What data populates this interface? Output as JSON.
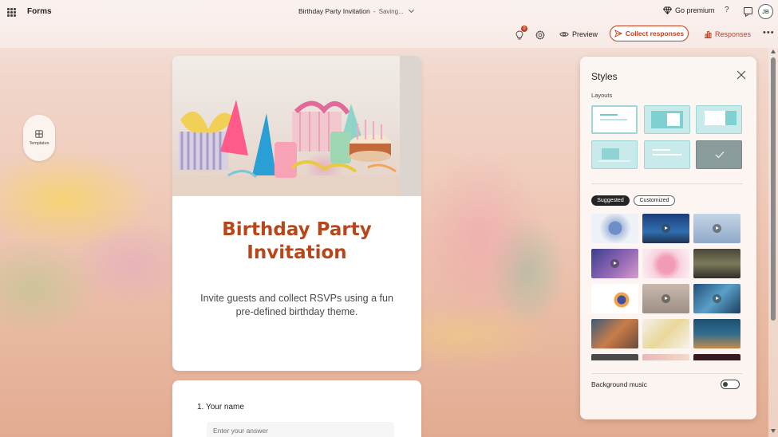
{
  "app": {
    "name": "Forms"
  },
  "document": {
    "title": "Birthday Party Invitation",
    "separator": "-",
    "status": "Saving..."
  },
  "header": {
    "premium_label": "Go premium",
    "help_label": "?",
    "avatar_initials": "JB"
  },
  "toolbar": {
    "ideas_badge": "0",
    "preview_label": "Preview",
    "collect_label": "Collect responses",
    "responses_label": "Responses",
    "more_label": "•••"
  },
  "templates": {
    "label": "Templates"
  },
  "form": {
    "title": "Birthday Party\nInvitation",
    "description": "Invite guests and collect RSVPs using a fun pre-defined birthday theme."
  },
  "question": {
    "label": "1.  Your name",
    "placeholder": "Enter your answer"
  },
  "styles_panel": {
    "title": "Styles",
    "layouts_label": "Layouts",
    "tabs": [
      "Suggested",
      "Customized"
    ],
    "background_music_label": "Background music",
    "background_music_on": false
  },
  "colors": {
    "accent": "#c43e1c",
    "title": "#b7471a",
    "layout_tile": "#c9eaea"
  }
}
